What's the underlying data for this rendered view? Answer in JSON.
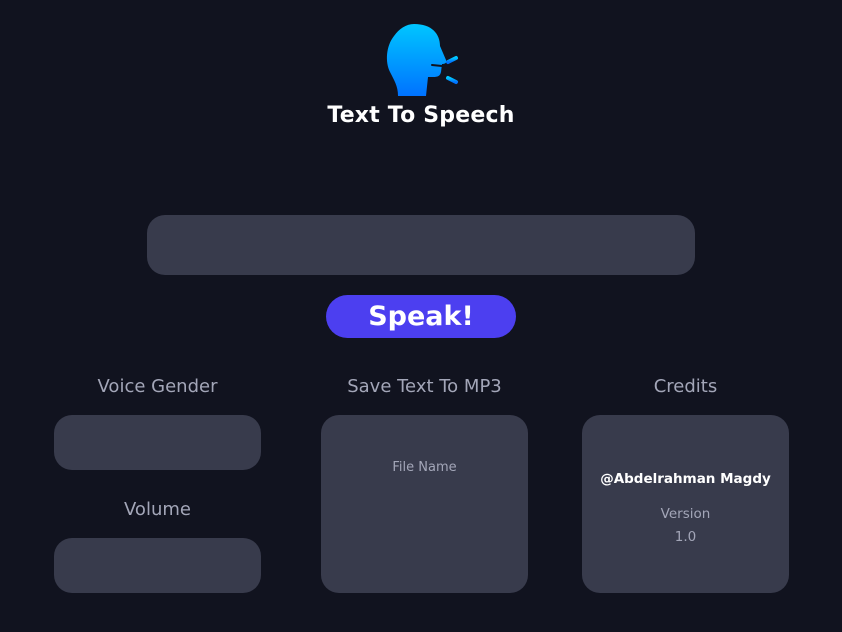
{
  "app": {
    "title": "Text To Speech",
    "logo_icon": "speaking-head-icon"
  },
  "text_input": {
    "value": "",
    "placeholder": ""
  },
  "speak_button": {
    "label": "Speak!"
  },
  "voice_gender": {
    "label": "Voice Gender",
    "selected": ""
  },
  "volume": {
    "label": "Volume"
  },
  "save_mp3": {
    "label": "Save Text To MP3",
    "file_name_label": "File Name"
  },
  "credits": {
    "label": "Credits",
    "author": "@Abdelrahman Magdy",
    "version_label": "Version",
    "version_value": "1.0"
  },
  "colors": {
    "background": "#11131f",
    "panel": "#383b4c",
    "accent": "#4c3ff0",
    "logo_gradient_top": "#00c6ff",
    "logo_gradient_bottom": "#0072ff"
  }
}
